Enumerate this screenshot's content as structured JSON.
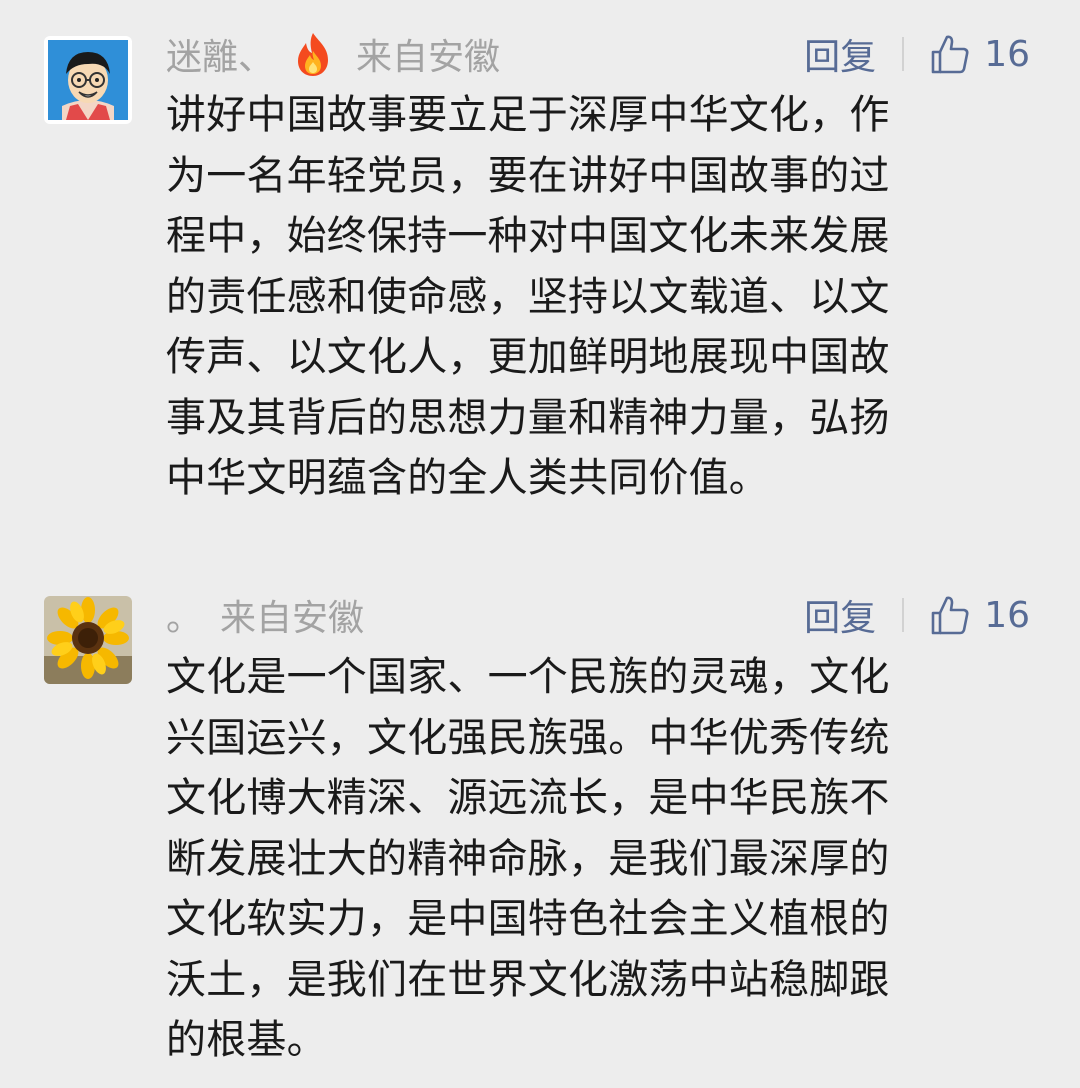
{
  "comments": [
    {
      "user": "迷離、",
      "has_fire_badge": true,
      "location": "来自安徽",
      "reply_label": "回复",
      "like_count": "16",
      "lines": [
        "讲好中国故事要立足于深厚中华文化，作",
        "为一名年轻党员，要在讲好中国故事的过",
        "程中，始终保持一种对中国文化未来发展",
        "的责任感和使命感，坚持以文载道、以文",
        "传声、以文化人，更加鲜明地展现中国故",
        "事及其背后的思想力量和精神力量，弘扬",
        "中华文明蕴含的全人类共同价值。"
      ]
    },
    {
      "user": "。",
      "has_fire_badge": false,
      "location": "来自安徽",
      "reply_label": "回复",
      "like_count": "16",
      "lines": [
        "文化是一个国家、一个民族的灵魂，文化",
        "兴国运兴，文化强民族强。中华优秀传统",
        "文化博大精深、源远流长，是中华民族不",
        "断发展壮大的精神命脉，是我们最深厚的",
        "文化软实力，是中国特色社会主义植根的",
        "沃土，是我们在世界文化激荡中站稳脚跟",
        "的根基。"
      ]
    }
  ],
  "colors": {
    "background": "#ededed",
    "meta_text": "#a3a3a3",
    "action_blue": "#576b95",
    "body_text": "#1a1a1a"
  }
}
